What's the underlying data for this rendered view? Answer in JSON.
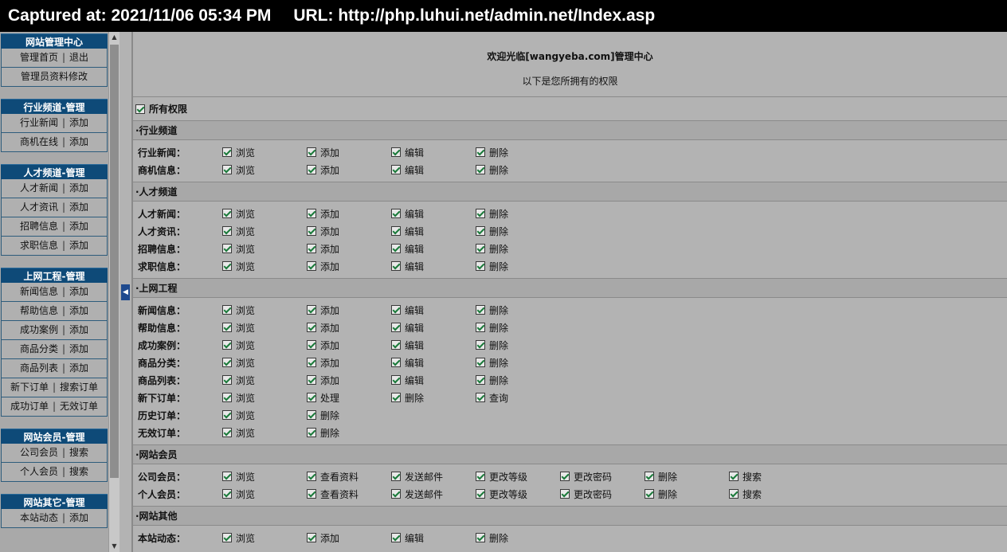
{
  "capture": {
    "time": "Captured at: 2021/11/06 05:34 PM",
    "url": "URL: http://php.luhui.net/admin.net/Index.asp"
  },
  "sidebar": [
    {
      "title": "网站管理中心",
      "items": [
        [
          "管理首页",
          "退出"
        ],
        [
          "管理员资料修改"
        ]
      ]
    },
    {
      "title": "行业频道-管理",
      "items": [
        [
          "行业新闻",
          "添加"
        ],
        [
          "商机在线",
          "添加"
        ]
      ]
    },
    {
      "title": "人才频道-管理",
      "items": [
        [
          "人才新闻",
          "添加"
        ],
        [
          "人才资讯",
          "添加"
        ],
        [
          "招聘信息",
          "添加"
        ],
        [
          "求职信息",
          "添加"
        ]
      ]
    },
    {
      "title": "上网工程-管理",
      "items": [
        [
          "新闻信息",
          "添加"
        ],
        [
          "帮助信息",
          "添加"
        ],
        [
          "成功案例",
          "添加"
        ],
        [
          "商品分类",
          "添加"
        ],
        [
          "商品列表",
          "添加"
        ],
        [
          "新下订单",
          "搜索订单"
        ],
        [
          "成功订单",
          "无效订单"
        ]
      ]
    },
    {
      "title": "网站会员-管理",
      "items": [
        [
          "公司会员",
          "搜索"
        ],
        [
          "个人会员",
          "搜索"
        ]
      ]
    },
    {
      "title": "网站其它-管理",
      "items": [
        [
          "本站动态",
          "添加"
        ]
      ]
    }
  ],
  "welcome": {
    "line1": "欢迎光临[wangyeba.com]管理中心",
    "line2": "以下是您所拥有的权限"
  },
  "all_permissions": "所有权限",
  "sections": [
    {
      "title": "·行业频道",
      "rows": [
        {
          "label": "行业新闻：",
          "options": [
            "浏览",
            "添加",
            "编辑",
            "删除"
          ]
        },
        {
          "label": "商机信息：",
          "options": [
            "浏览",
            "添加",
            "编辑",
            "删除"
          ]
        }
      ]
    },
    {
      "title": "·人才频道",
      "rows": [
        {
          "label": "人才新闻：",
          "options": [
            "浏览",
            "添加",
            "编辑",
            "删除"
          ]
        },
        {
          "label": "人才资讯：",
          "options": [
            "浏览",
            "添加",
            "编辑",
            "删除"
          ]
        },
        {
          "label": "招聘信息：",
          "options": [
            "浏览",
            "添加",
            "编辑",
            "删除"
          ]
        },
        {
          "label": "求职信息：",
          "options": [
            "浏览",
            "添加",
            "编辑",
            "删除"
          ]
        }
      ]
    },
    {
      "title": "·上网工程",
      "rows": [
        {
          "label": "新闻信息：",
          "options": [
            "浏览",
            "添加",
            "编辑",
            "删除"
          ]
        },
        {
          "label": "帮助信息：",
          "options": [
            "浏览",
            "添加",
            "编辑",
            "删除"
          ]
        },
        {
          "label": "成功案例：",
          "options": [
            "浏览",
            "添加",
            "编辑",
            "删除"
          ]
        },
        {
          "label": "商品分类：",
          "options": [
            "浏览",
            "添加",
            "编辑",
            "删除"
          ]
        },
        {
          "label": "商品列表：",
          "options": [
            "浏览",
            "添加",
            "编辑",
            "删除"
          ]
        },
        {
          "label": "新下订单：",
          "options": [
            "浏览",
            "处理",
            "删除",
            "查询"
          ]
        },
        {
          "label": "历史订单：",
          "options": [
            "浏览",
            "删除"
          ]
        },
        {
          "label": "无效订单：",
          "options": [
            "浏览",
            "删除"
          ]
        }
      ]
    },
    {
      "title": "·网站会员",
      "rows": [
        {
          "label": "公司会员：",
          "options": [
            "浏览",
            "查看资料",
            "发送邮件",
            "更改等级",
            "更改密码",
            "删除",
            "搜索"
          ]
        },
        {
          "label": "个人会员：",
          "options": [
            "浏览",
            "查看资料",
            "发送邮件",
            "更改等级",
            "更改密码",
            "删除",
            "搜索"
          ]
        }
      ]
    },
    {
      "title": "·网站其他",
      "rows": [
        {
          "label": "本站动态：",
          "options": [
            "浏览",
            "添加",
            "编辑",
            "删除"
          ]
        }
      ]
    }
  ]
}
